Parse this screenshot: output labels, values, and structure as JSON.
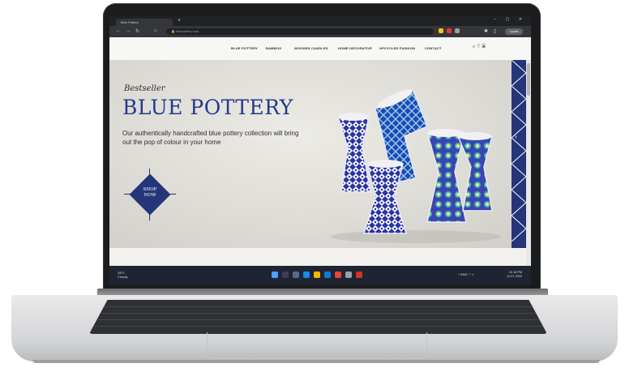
{
  "browser": {
    "tab_title": "Blue Pottery",
    "new_tab": "+",
    "window_controls": "– ▢ ✕",
    "address": "🔒 bluepottery.com",
    "profile": "Update"
  },
  "site": {
    "nav": [
      "BLUE POTTERY",
      "BAMBOO",
      "WOODEN CANDLES",
      "HOME DECORATIVE",
      "UPCYCLED FASHION",
      "CONTACT"
    ],
    "nav_icons": "⌕ ♡ ▣",
    "hero": {
      "kicker": "Bestseller",
      "headline": "BLUE POTTERY",
      "copy": "Our authentically handcrafted blue pottery collection will bring out the pop of colour in your home",
      "cta_line1": "SHOP",
      "cta_line2": "NOW"
    },
    "slider_dots": "•••",
    "next_arrow": "›"
  },
  "taskbar": {
    "weather_temp": "28°C",
    "weather_desc": "Cloudy",
    "tray": "^ ENG ⌔ ◐",
    "time": "10:18 PM",
    "date": "11-07-2022"
  },
  "colors": {
    "brand_blue": "#233a8b",
    "taskbar": "#1f2433",
    "chrome": "#35363a"
  }
}
